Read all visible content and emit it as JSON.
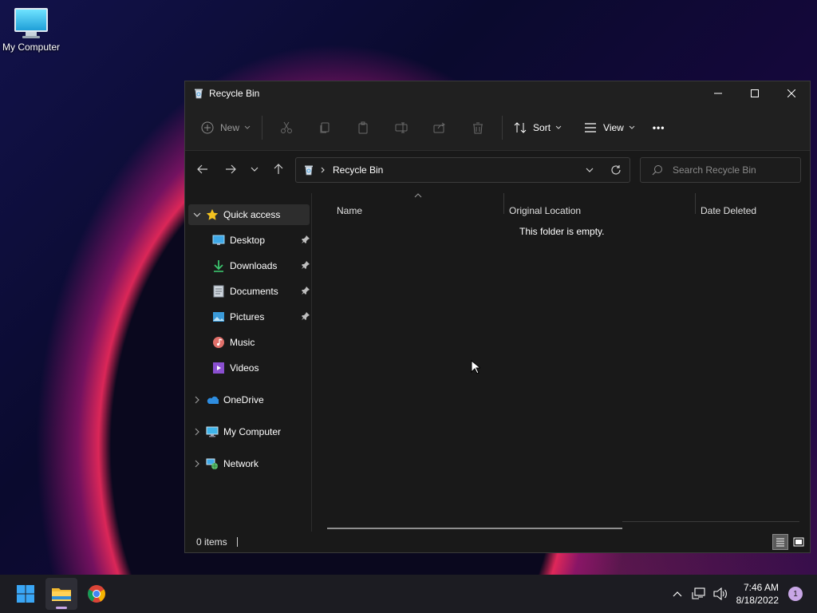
{
  "desktop": {
    "icon_label": "My Computer"
  },
  "window": {
    "title": "Recycle Bin",
    "controls": {
      "minimize": "—",
      "maximize": "☐",
      "close": "✕"
    }
  },
  "toolbar": {
    "new_label": "New",
    "sort_label": "Sort",
    "view_label": "View",
    "more_label": "•••"
  },
  "nav": {
    "breadcrumb": "Recycle Bin",
    "search_placeholder": "Search Recycle Bin"
  },
  "sidebar": {
    "items": [
      {
        "label": "Quick access"
      },
      {
        "label": "Desktop"
      },
      {
        "label": "Downloads"
      },
      {
        "label": "Documents"
      },
      {
        "label": "Pictures"
      },
      {
        "label": "Music"
      },
      {
        "label": "Videos"
      },
      {
        "label": "OneDrive"
      },
      {
        "label": "My Computer"
      },
      {
        "label": "Network"
      }
    ]
  },
  "content": {
    "columns": [
      "Name",
      "Original Location",
      "Date Deleted"
    ],
    "empty_message": "This folder is empty."
  },
  "status": {
    "item_count": "0 items"
  },
  "taskbar": {
    "time": "7:46 AM",
    "date": "8/18/2022",
    "notification_count": "1"
  }
}
